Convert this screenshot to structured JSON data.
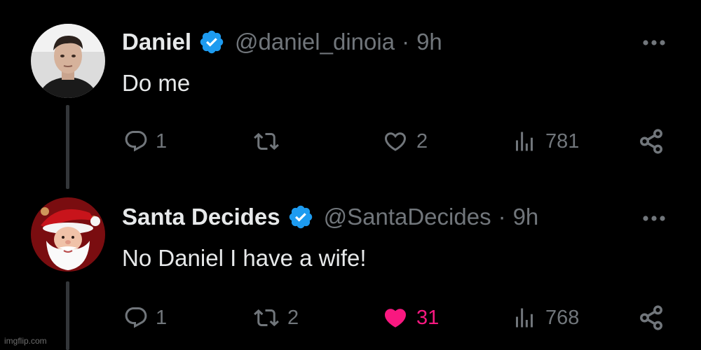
{
  "tweets": [
    {
      "name": "Daniel",
      "handle": "@daniel_dinoia",
      "separator": "·",
      "time": "9h",
      "text": "Do me",
      "verified": true,
      "avatar": "man-portrait-photo",
      "actions": {
        "replies": "1",
        "retweets": "",
        "likes": "2",
        "liked": false,
        "views": "781"
      }
    },
    {
      "name": "Santa Decides",
      "handle": "@SantaDecides",
      "separator": "·",
      "time": "9h",
      "text": "No Daniel I have a wife!",
      "verified": true,
      "avatar": "santa-claus-photo",
      "actions": {
        "replies": "1",
        "retweets": "2",
        "likes": "31",
        "liked": true,
        "views": "768"
      }
    }
  ],
  "colors": {
    "background": "#000000",
    "primary_text": "#e7e9ea",
    "secondary_text": "#71767b",
    "verified_blue": "#1d9bf0",
    "like_pink": "#f91880"
  },
  "watermark": "imgflip.com"
}
